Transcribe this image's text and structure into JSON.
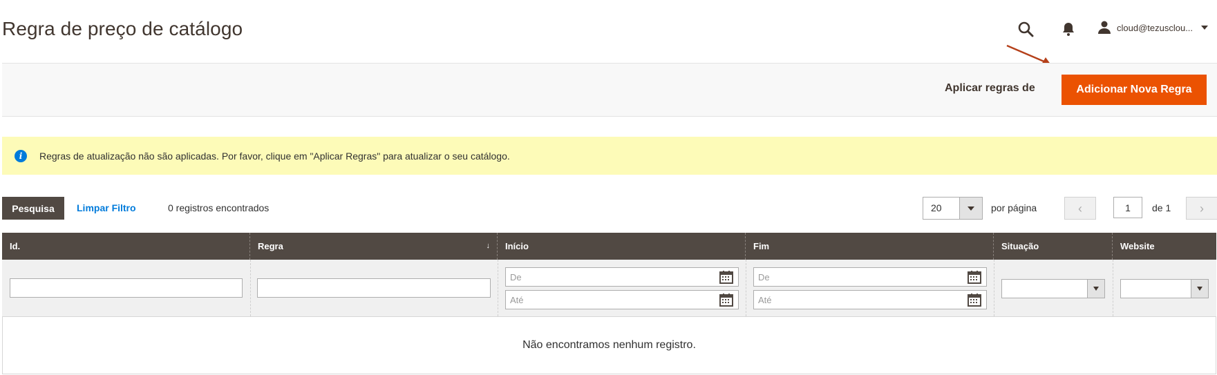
{
  "header": {
    "title": "Regra de preço de catálogo",
    "user_label": "cloud@tezusclou..."
  },
  "actions": {
    "apply_label": "Aplicar regras de",
    "add_label": "Adicionar Nova Regra"
  },
  "message": {
    "text": "Regras de atualização não são aplicadas. Por favor, clique em \"Aplicar Regras\" para atualizar o seu catálogo."
  },
  "toolbar": {
    "search_label": "Pesquisa",
    "clear_label": "Limpar Filtro",
    "records_text": "0 registros encontrados",
    "per_page_value": "20",
    "per_page_label": "por página",
    "current_page": "1",
    "page_of": "de 1"
  },
  "grid": {
    "columns": [
      "Id.",
      "Regra",
      "Início",
      "Fim",
      "Situação",
      "Website"
    ],
    "filters": {
      "from_placeholder": "De",
      "to_placeholder": "Até"
    },
    "empty_text": "Não encontramos nenhum registro."
  },
  "colors": {
    "accent": "#eb5202",
    "header_bg": "#514943",
    "link": "#007bdb",
    "message_bg": "#fdfbb8"
  },
  "icons": [
    "search-icon",
    "bell-icon",
    "user-icon",
    "info-icon",
    "calendar-icon",
    "chevron-left-icon",
    "chevron-right-icon"
  ]
}
